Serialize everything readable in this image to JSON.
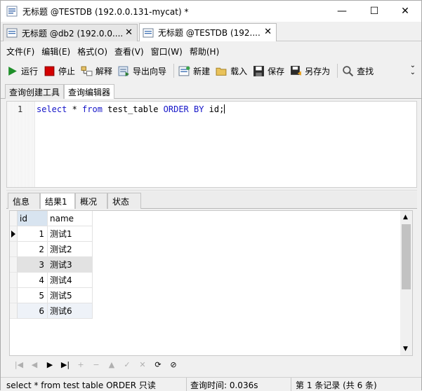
{
  "window": {
    "title": "无标题 @TESTDB (192.0.0.131-mycat) *",
    "controls": {
      "minimize": "—",
      "maximize": "☐",
      "close": "✕"
    }
  },
  "doc_tabs": [
    {
      "label": "无标题 @db2 (192.0.0....",
      "close": "✕"
    },
    {
      "label": "无标题 @TESTDB (192....",
      "close": "✕"
    }
  ],
  "menu": [
    "文件(F)",
    "编辑(E)",
    "格式(O)",
    "查看(V)",
    "窗口(W)",
    "帮助(H)"
  ],
  "toolbar": {
    "run": "运行",
    "stop": "停止",
    "explain": "解释",
    "export_wizard": "导出向导",
    "new": "新建",
    "load": "载入",
    "save": "保存",
    "save_as": "另存为",
    "find": "查找"
  },
  "query_tabs": [
    "查询创建工具",
    "查询编辑器"
  ],
  "editor": {
    "line_number": "1",
    "tokens": [
      {
        "text": "select",
        "kind": "kw"
      },
      {
        "text": " * ",
        "kind": "plain"
      },
      {
        "text": "from",
        "kind": "kw"
      },
      {
        "text": " test_table ",
        "kind": "plain"
      },
      {
        "text": "ORDER BY",
        "kind": "kw"
      },
      {
        "text": " id;",
        "kind": "plain"
      }
    ]
  },
  "result_tabs": [
    "信息",
    "结果1",
    "概况",
    "状态"
  ],
  "grid": {
    "columns": [
      "id",
      "name"
    ],
    "rows": [
      {
        "id": "1",
        "name": "测试1"
      },
      {
        "id": "2",
        "name": "测试2"
      },
      {
        "id": "3",
        "name": "测试3"
      },
      {
        "id": "4",
        "name": "测试4"
      },
      {
        "id": "5",
        "name": "测试5"
      },
      {
        "id": "6",
        "name": "测试6"
      }
    ]
  },
  "navigator": [
    "|◀",
    "◀",
    "▶",
    "▶|",
    "+",
    "−",
    "▲",
    "✓",
    "✕",
    "⟳",
    "⊘"
  ],
  "status": {
    "sql": "select * from test table ORDER 只读",
    "query_time": "查询时间: 0.036s",
    "records": "第 1 条记录 (共 6 条)"
  },
  "colors": {
    "keyword": "#1515c8",
    "header_id_bg": "#d8e4f0",
    "run": "#1f8f2a",
    "stop": "#d40000"
  }
}
